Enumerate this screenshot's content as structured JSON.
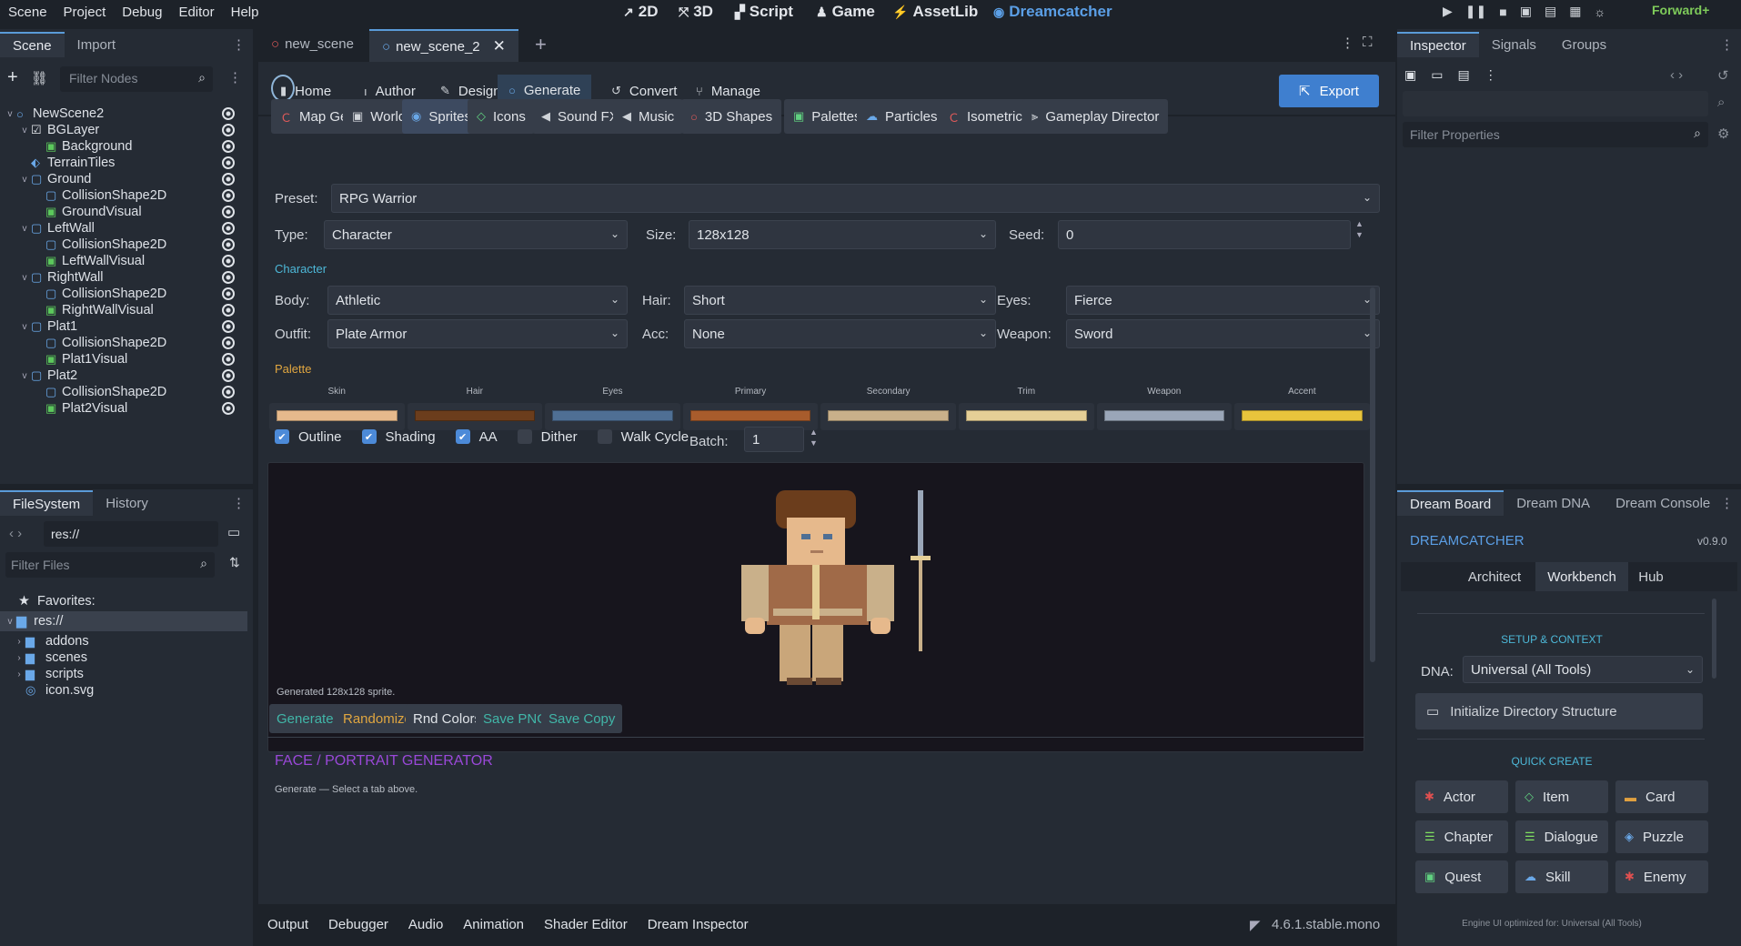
{
  "menu": [
    "Scene",
    "Project",
    "Debug",
    "Editor",
    "Help"
  ],
  "workspaces": [
    {
      "icon": "2d-icon",
      "label": "2D"
    },
    {
      "icon": "3d-icon",
      "label": "3D"
    },
    {
      "icon": "script-icon",
      "label": "Script"
    },
    {
      "icon": "game-icon",
      "label": "Game"
    },
    {
      "icon": "assetlib-icon",
      "label": "AssetLib"
    },
    {
      "icon": "dreamcatcher-icon",
      "label": "Dreamcatcher"
    }
  ],
  "renderer": "Forward+",
  "left_dock": {
    "tabs": [
      "Scene",
      "Import"
    ],
    "filter_placeholder": "Filter Nodes",
    "tree": [
      {
        "label": "NewScene2",
        "depth": 0,
        "icon": "node",
        "arrow": "v"
      },
      {
        "label": "BGLayer",
        "depth": 1,
        "icon": "layer",
        "arrow": "v"
      },
      {
        "label": "Background",
        "depth": 2,
        "icon": "sprite",
        "arrow": ""
      },
      {
        "label": "TerrainTiles",
        "depth": 1,
        "icon": "tiles",
        "arrow": ""
      },
      {
        "label": "Ground",
        "depth": 1,
        "icon": "body",
        "arrow": "v"
      },
      {
        "label": "CollisionShape2D",
        "depth": 2,
        "icon": "shape",
        "arrow": ""
      },
      {
        "label": "GroundVisual",
        "depth": 2,
        "icon": "sprite",
        "arrow": ""
      },
      {
        "label": "LeftWall",
        "depth": 1,
        "icon": "body",
        "arrow": "v"
      },
      {
        "label": "CollisionShape2D",
        "depth": 2,
        "icon": "shape",
        "arrow": ""
      },
      {
        "label": "LeftWallVisual",
        "depth": 2,
        "icon": "sprite",
        "arrow": ""
      },
      {
        "label": "RightWall",
        "depth": 1,
        "icon": "body",
        "arrow": "v"
      },
      {
        "label": "CollisionShape2D",
        "depth": 2,
        "icon": "shape",
        "arrow": ""
      },
      {
        "label": "RightWallVisual",
        "depth": 2,
        "icon": "sprite",
        "arrow": ""
      },
      {
        "label": "Plat1",
        "depth": 1,
        "icon": "body",
        "arrow": "v"
      },
      {
        "label": "CollisionShape2D",
        "depth": 2,
        "icon": "shape",
        "arrow": ""
      },
      {
        "label": "Plat1Visual",
        "depth": 2,
        "icon": "sprite",
        "arrow": ""
      },
      {
        "label": "Plat2",
        "depth": 1,
        "icon": "body",
        "arrow": "v"
      },
      {
        "label": "CollisionShape2D",
        "depth": 2,
        "icon": "shape",
        "arrow": ""
      },
      {
        "label": "Plat2Visual",
        "depth": 2,
        "icon": "sprite",
        "arrow": ""
      }
    ]
  },
  "filesystem": {
    "tabs": [
      "FileSystem",
      "History"
    ],
    "path": "res://",
    "filter_placeholder": "Filter Files",
    "favorites_label": "Favorites:",
    "root": "res://",
    "items": [
      "addons",
      "scenes",
      "scripts",
      "icon.svg"
    ]
  },
  "scene_tabs": [
    "new_scene",
    "new_scene_2"
  ],
  "main_nav": [
    "Home",
    "Author",
    "Design",
    "Generate",
    "Convert",
    "Manage"
  ],
  "export_label": "Export",
  "gen_tabs": [
    "Map Gen",
    "World",
    "Sprites",
    "Icons",
    "Sound FX",
    "Music",
    "3D Shapes",
    "Palettes",
    "Particles",
    "Isometric",
    "Gameplay Director"
  ],
  "form": {
    "preset_label": "Preset:",
    "preset": "RPG Warrior",
    "type_label": "Type:",
    "type": "Character",
    "size_label": "Size:",
    "size": "128x128",
    "seed_label": "Seed:",
    "seed": "0",
    "section_character": "Character",
    "body_label": "Body:",
    "body": "Athletic",
    "hair_label": "Hair:",
    "hair": "Short",
    "eyes_label": "Eyes:",
    "eyes": "Fierce",
    "outfit_label": "Outfit:",
    "outfit": "Plate Armor",
    "acc_label": "Acc:",
    "acc": "None",
    "weapon_label": "Weapon:",
    "weapon": "Sword",
    "section_palette": "Palette",
    "palette": [
      {
        "name": "Skin",
        "color": "#e6b98c"
      },
      {
        "name": "Hair",
        "color": "#6b3d1c"
      },
      {
        "name": "Eyes",
        "color": "#4f6f94"
      },
      {
        "name": "Primary",
        "color": "#a85c2c"
      },
      {
        "name": "Secondary",
        "color": "#c9b08a"
      },
      {
        "name": "Trim",
        "color": "#e5cf96"
      },
      {
        "name": "Weapon",
        "color": "#9aa6b8"
      },
      {
        "name": "Accent",
        "color": "#e8c43c"
      }
    ],
    "options": [
      {
        "label": "Outline",
        "checked": true
      },
      {
        "label": "Shading",
        "checked": true
      },
      {
        "label": "AA",
        "checked": true
      },
      {
        "label": "Dither",
        "checked": false
      },
      {
        "label": "Walk Cycle",
        "checked": false
      }
    ],
    "batch_label": "Batch:",
    "batch": "1",
    "status": "Generated 128x128 sprite.",
    "actions": [
      "Generate",
      "Randomize",
      "Rnd Colors",
      "Save PNG",
      "Save Copy"
    ],
    "face_title": "FACE / PORTRAIT GENERATOR",
    "face_hint": "Generate — Select a tab above."
  },
  "bottom_tabs": [
    "Output",
    "Debugger",
    "Audio",
    "Animation",
    "Shader Editor",
    "Dream Inspector"
  ],
  "version": "4.6.1.stable.mono",
  "inspector": {
    "tabs": [
      "Inspector",
      "Signals",
      "Groups"
    ],
    "filter_placeholder": "Filter Properties"
  },
  "dream": {
    "tabs": [
      "Dream Board",
      "Dream DNA",
      "Dream Console"
    ],
    "title": "DREAMCATCHER",
    "version": "v0.9.0",
    "subtabs": [
      "Architect",
      "Workbench",
      "Hub"
    ],
    "setup_title": "SETUP & CONTEXT",
    "dna_label": "DNA:",
    "dna": "Universal (All Tools)",
    "init_label": "Initialize Directory Structure",
    "quick_title": "QUICK CREATE",
    "quick": [
      {
        "label": "Actor",
        "icon": "actor-icon",
        "color": "#e05050"
      },
      {
        "label": "Item",
        "icon": "item-icon",
        "color": "#60d080"
      },
      {
        "label": "Card",
        "icon": "card-icon",
        "color": "#e0a040"
      },
      {
        "label": "Chapter",
        "icon": "chapter-icon",
        "color": "#80e060"
      },
      {
        "label": "Dialogue",
        "icon": "dialogue-icon",
        "color": "#80e060"
      },
      {
        "label": "Puzzle",
        "icon": "puzzle-icon",
        "color": "#6aa8e8"
      },
      {
        "label": "Quest",
        "icon": "quest-icon",
        "color": "#60d080"
      },
      {
        "label": "Skill",
        "icon": "skill-icon",
        "color": "#6aa8e8"
      },
      {
        "label": "Enemy",
        "icon": "enemy-icon",
        "color": "#e05050"
      }
    ],
    "footer": "Engine UI optimized for: Universal (All Tools)"
  },
  "colors": {
    "accent": "#4d8fd6",
    "teal": "#41b6a8",
    "orange": "#e0a640",
    "purple": "#9a48d8",
    "bg": "#1d2229",
    "panel": "#252b34"
  }
}
